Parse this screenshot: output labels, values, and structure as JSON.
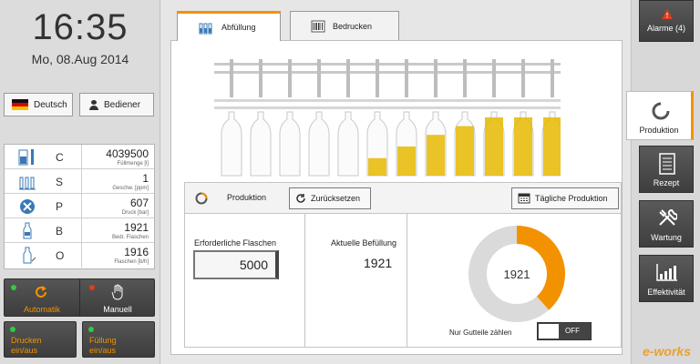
{
  "clock": {
    "time": "16:35",
    "date": "Mo, 08.Aug 2014"
  },
  "language_button": {
    "label": "Deutsch",
    "icon": "germany-flag-icon"
  },
  "user_button": {
    "label": "Bediener",
    "icon": "user-icon"
  },
  "stats": [
    {
      "letter": "C",
      "value": "4039500",
      "unit": "Füllmenge [l]",
      "icon": "fill-level-icon"
    },
    {
      "letter": "S",
      "value": "1",
      "unit": "Geschw. [ppm]",
      "icon": "bottles-speed-icon"
    },
    {
      "letter": "P",
      "value": "607",
      "unit": "Druck [bar]",
      "icon": "pressure-icon"
    },
    {
      "letter": "B",
      "value": "1921",
      "unit": "Bedr. Flaschen",
      "icon": "bottle-printed-icon"
    },
    {
      "letter": "O",
      "value": "1916",
      "unit": "Flaschen [b/h]",
      "icon": "bottle-output-icon"
    }
  ],
  "mode": {
    "auto_label": "Automatik",
    "manual_label": "Manuell"
  },
  "toggles": {
    "print_label": "Drucken ein/aus",
    "fill_label": "Füllung ein/aus"
  },
  "tabs": [
    {
      "label": "Abfüllung",
      "active": true,
      "icon": "bottles-icon"
    },
    {
      "label": "Bedrucken",
      "active": false,
      "icon": "barcode-icon"
    }
  ],
  "bottle_fill_levels": [
    0,
    0,
    0,
    0,
    0,
    0.3,
    0.5,
    0.7,
    0.85,
    1,
    1,
    1
  ],
  "production": {
    "title": "Produktion",
    "reset_label": "Zurücksetzen",
    "daily_label": "Tägliche Produktion",
    "required_label": "Erforderliche Flaschen",
    "required_value": "5000",
    "current_label": "Aktuelle Befüllung",
    "current_value": "1921",
    "donut_value": "1921",
    "donut_fraction": 0.3842,
    "count_good_label": "Nur Gutteile zählen",
    "toggle_state": "OFF"
  },
  "right_nav": {
    "alarm_label": "Alarme (4)",
    "items": [
      {
        "label": "Produktion",
        "icon": "production-icon",
        "active": true
      },
      {
        "label": "Rezept",
        "icon": "recipe-icon",
        "active": false
      },
      {
        "label": "Wartung",
        "icon": "maintenance-icon",
        "active": false
      },
      {
        "label": "Effektivität",
        "icon": "effectiveness-icon",
        "active": false
      }
    ]
  },
  "watermark": "e-works",
  "colors": {
    "accent": "#f39200",
    "gold": "#e6b800",
    "led_green": "#2ecc40",
    "led_red": "#e03c1e"
  }
}
